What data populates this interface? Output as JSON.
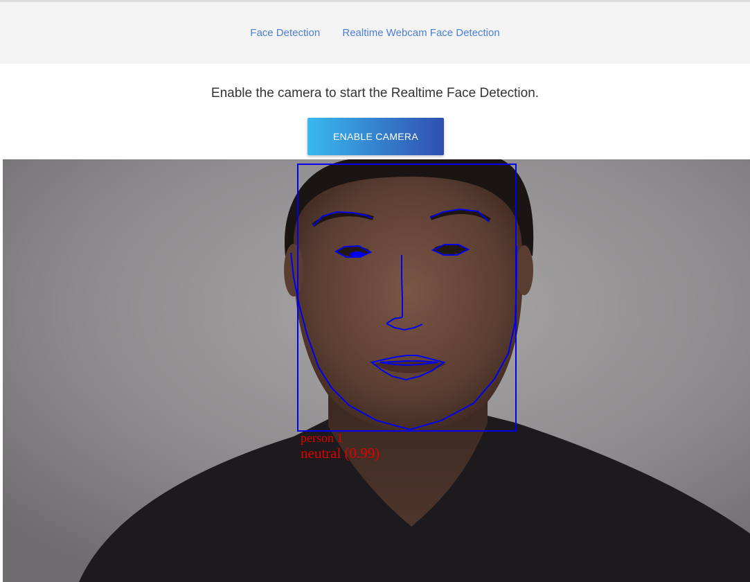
{
  "nav": {
    "links": [
      {
        "label": "Face Detection"
      },
      {
        "label": "Realtime Webcam Face Detection"
      }
    ]
  },
  "intro": {
    "text": "Enable the camera to start the Realtime Face Detection."
  },
  "button": {
    "label": "ENABLE CAMERA"
  },
  "detection": {
    "name": "person 1",
    "expression": "neutral (0.99)",
    "box_color": "#0000ee",
    "label_color": "#e00000"
  },
  "colors": {
    "nav_link": "#4a7fd8",
    "topbar_bg": "#f4f4f4",
    "button_gradient_start": "#3ab8ee",
    "button_gradient_end": "#2f4fb0"
  }
}
